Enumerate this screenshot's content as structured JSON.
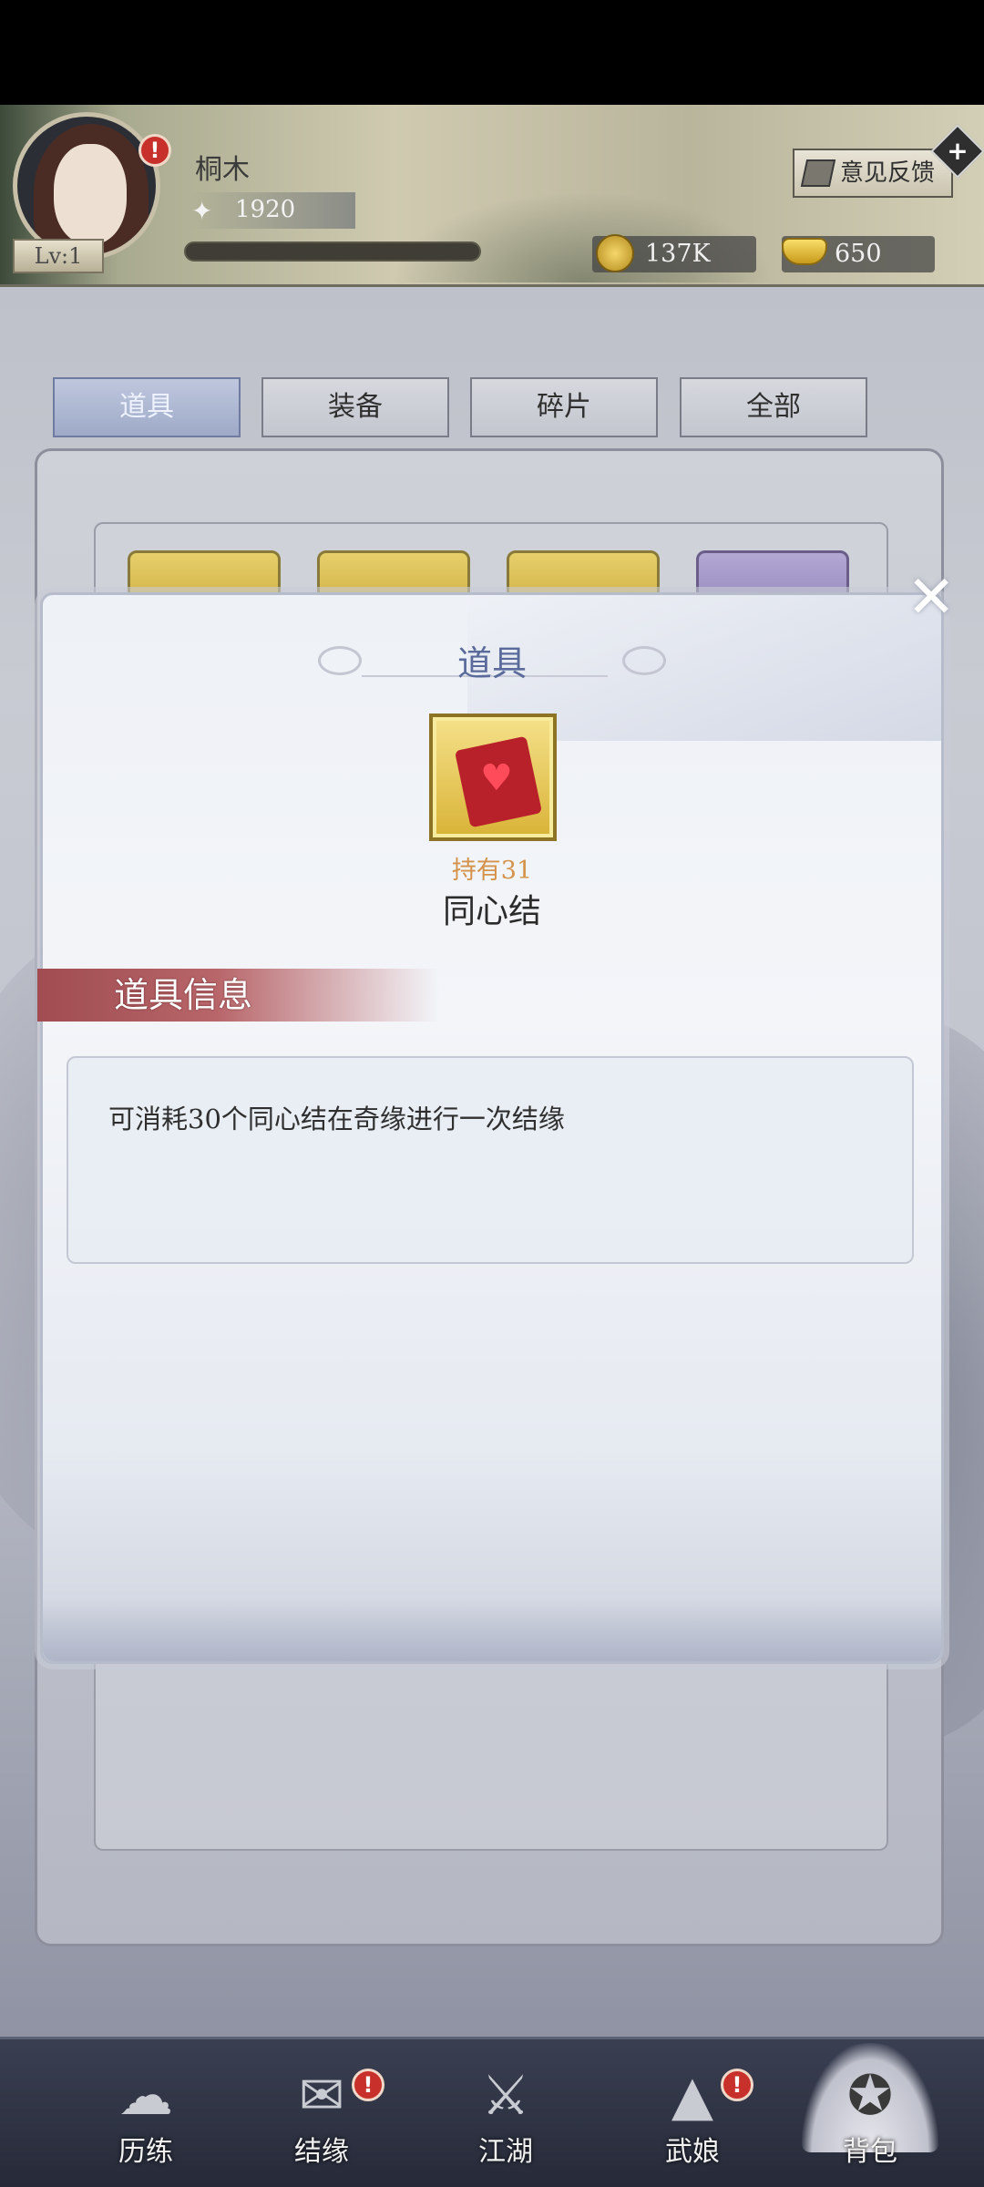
{
  "header": {
    "player_name": "桐木",
    "level": "Lv:1",
    "power": "1920",
    "feedback_label": "意见反馈",
    "coins": "137K",
    "ingots": "650"
  },
  "tabs": [
    {
      "label": "道具",
      "active": true
    },
    {
      "label": "装备",
      "active": false
    },
    {
      "label": "碎片",
      "active": false
    },
    {
      "label": "全部",
      "active": false
    }
  ],
  "modal": {
    "title": "道具",
    "owned_text": "持有31",
    "item_name": "同心结",
    "section_title": "道具信息",
    "description": "可消耗30个同心结在奇缘进行一次结缘"
  },
  "bottom_nav": [
    {
      "label": "历练",
      "icon": "cloud-icon",
      "alert": false
    },
    {
      "label": "结缘",
      "icon": "scroll-icon",
      "alert": true
    },
    {
      "label": "江湖",
      "icon": "crossed-swords-icon",
      "alert": false
    },
    {
      "label": "武娘",
      "icon": "bamboo-hat-icon",
      "alert": true
    },
    {
      "label": "背包",
      "icon": "bag-icon",
      "alert": false,
      "active": true
    }
  ],
  "colors": {
    "accent_blue": "#5a6a9a",
    "owned_orange": "#d4924a",
    "banner_red": "#a04c51",
    "alert_red": "#c8312b"
  }
}
